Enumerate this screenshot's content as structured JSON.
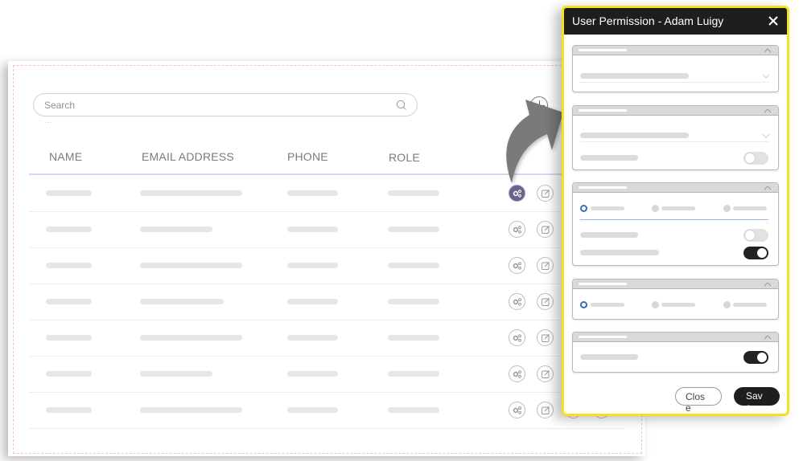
{
  "search": {
    "placeholder": "Search",
    "hint": "..."
  },
  "table": {
    "columns": [
      "NAME",
      "EMAIL ADDRESS",
      "PHONE",
      "ROLE"
    ],
    "rows": [
      {
        "name": "",
        "email": "",
        "phone": "",
        "role": "",
        "settings_active": true
      },
      {
        "name": "",
        "email": "",
        "phone": "",
        "role": "",
        "settings_active": false
      },
      {
        "name": "",
        "email": "",
        "phone": "",
        "role": "",
        "settings_active": false
      },
      {
        "name": "",
        "email": "",
        "phone": "",
        "role": "",
        "settings_active": false
      },
      {
        "name": "",
        "email": "",
        "phone": "",
        "role": "",
        "settings_active": false
      },
      {
        "name": "",
        "email": "",
        "phone": "",
        "role": "",
        "settings_active": false
      },
      {
        "name": "",
        "email": "",
        "phone": "",
        "role": "",
        "settings_active": false
      }
    ],
    "row_actions": [
      "permissions-icon",
      "edit-icon",
      "delete-icon",
      "remove-icon"
    ]
  },
  "icons": {
    "search": "search-icon",
    "add": "plus-icon",
    "arrow": "curved-arrow-icon",
    "close": "close-icon",
    "collapse": "chevron-up-icon",
    "dropdown": "chevron-down-icon"
  },
  "modal": {
    "title": "User Permission -  Adam Luigy",
    "sections": [
      {
        "type": "select",
        "expanded": true
      },
      {
        "type": "select-toggle",
        "expanded": true,
        "toggles": [
          false
        ]
      },
      {
        "type": "radio-toggles",
        "expanded": true,
        "radio_selected": 0,
        "radio_count": 3,
        "toggles": [
          false,
          true
        ]
      },
      {
        "type": "radio",
        "expanded": true,
        "radio_selected": 0,
        "radio_count": 3
      },
      {
        "type": "toggle",
        "expanded": true,
        "toggles": [
          true
        ]
      }
    ],
    "close_label": "Close",
    "save_label": "Save"
  },
  "colors": {
    "modal_border": "#f4e21c",
    "modal_header": "#1f1d1e",
    "accent_purple": "#6a6384",
    "radio_blue": "#3d6cb5",
    "header_divider": "#dcd2f4"
  }
}
